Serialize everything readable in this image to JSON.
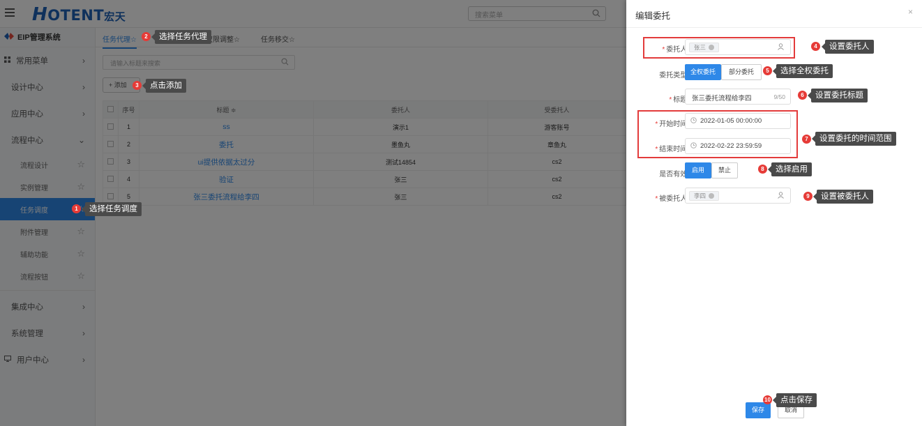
{
  "topbar": {
    "logo_main": "OTENT",
    "logo_h": "H",
    "logo_cn": "宏天",
    "search_placeholder": "搜索菜单"
  },
  "sidebar": {
    "system_title": "EIP管理系统",
    "common_menu": "常用菜单",
    "items": [
      {
        "label": "设计中心"
      },
      {
        "label": "应用中心"
      },
      {
        "label": "流程中心"
      }
    ],
    "flow_children": [
      {
        "label": "流程设计"
      },
      {
        "label": "实例管理"
      },
      {
        "label": "任务调度"
      },
      {
        "label": "附件管理"
      },
      {
        "label": "辅助功能"
      },
      {
        "label": "流程按钮"
      }
    ],
    "items_bottom": [
      {
        "label": "集成中心"
      },
      {
        "label": "系统管理"
      },
      {
        "label": "用户中心"
      }
    ]
  },
  "main": {
    "tabs": [
      {
        "label": "任务代理☆"
      },
      {
        "label": "权限调整☆"
      },
      {
        "label": "任务移交☆"
      }
    ],
    "search_placeholder": "请输入标题来搜索",
    "add_label": "+ 添加",
    "columns": [
      "序号",
      "标题 ≑",
      "委托人",
      "受委托人"
    ],
    "rows": [
      {
        "no": "1",
        "title": "ss",
        "from": "演示1",
        "to": "游客账号"
      },
      {
        "no": "2",
        "title": "委托",
        "from": "墨鱼丸",
        "to": "章鱼丸"
      },
      {
        "no": "3",
        "title": "ui提供依据太过分",
        "from": "测试14854",
        "to": "cs2"
      },
      {
        "no": "4",
        "title": "验证",
        "from": "张三",
        "to": "cs2"
      },
      {
        "no": "5",
        "title": "张三委托流程给李四",
        "from": "张三",
        "to": "cs2"
      }
    ]
  },
  "drawer": {
    "title": "编辑委托",
    "close": "×",
    "delegator_label": "委托人:",
    "delegator_value": "张三",
    "type_label": "委托类型:",
    "type_options": [
      "全权委托",
      "部分委托"
    ],
    "title_label": "标题:",
    "title_value": "张三委托流程给李四",
    "title_counter": "9/50",
    "start_label": "开始时间:",
    "start_value": "2022-01-05 00:00:00",
    "end_label": "结束时间:",
    "end_value": "2022-02-22 23:59:59",
    "valid_label": "是否有效:",
    "valid_options": [
      "启用",
      "禁止"
    ],
    "delegatee_label": "被委托人:",
    "delegatee_value": "李四",
    "save_label": "保存",
    "cancel_label": "取消"
  },
  "callouts": [
    {
      "n": "1",
      "text": "选择任务调度"
    },
    {
      "n": "2",
      "text": "选择任务代理"
    },
    {
      "n": "3",
      "text": "点击添加"
    },
    {
      "n": "4",
      "text": "设置委托人"
    },
    {
      "n": "5",
      "text": "选择全权委托"
    },
    {
      "n": "6",
      "text": "设置委托标题"
    },
    {
      "n": "7",
      "text": "设置委托的时间范围"
    },
    {
      "n": "8",
      "text": "选择启用"
    },
    {
      "n": "9",
      "text": "设置被委托人"
    },
    {
      "n": "10",
      "text": "点击保存"
    }
  ],
  "colors": {
    "accent": "#2e88e8",
    "callout_red": "#e63b37",
    "brand_blue": "#1e63b8"
  }
}
